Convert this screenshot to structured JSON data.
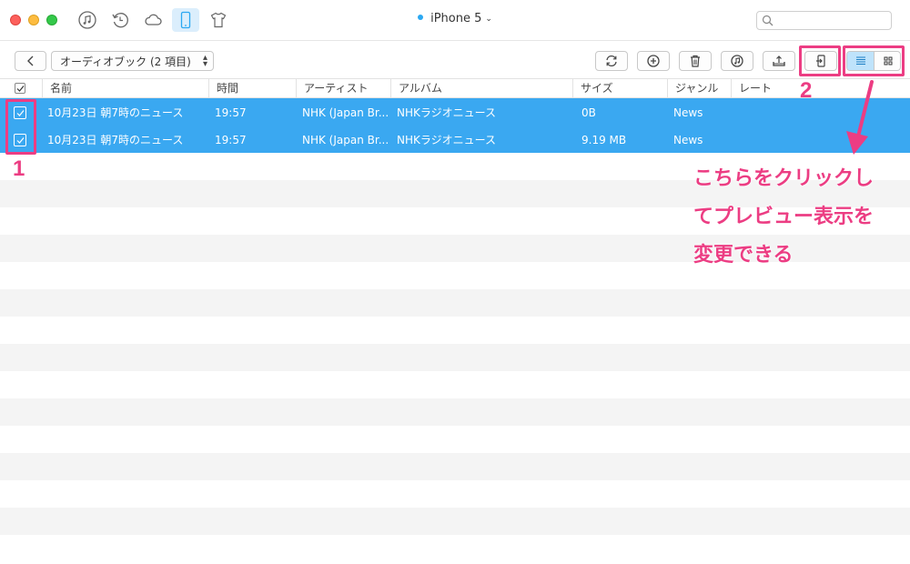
{
  "titlebar": {
    "device_name": "iPhone 5",
    "search_placeholder": "",
    "icons": [
      "music-icon",
      "restore-icon",
      "cloud-icon",
      "phone-icon",
      "tshirt-icon"
    ]
  },
  "toolbar": {
    "dropdown_label": "オーディオブック (2 項目)",
    "actions": [
      "refresh-icon",
      "add-icon",
      "delete-icon",
      "add-to-itunes-icon",
      "export-to-pc-icon",
      "send-to-device-icon"
    ]
  },
  "table": {
    "columns": [
      "名前",
      "時間",
      "アーティスト",
      "アルバム",
      "サイズ",
      "ジャンル",
      "レート"
    ],
    "rows": [
      {
        "name": "10月23日 朝7時のニュース",
        "time": "19:57",
        "artist": "NHK (Japan Br...",
        "album": "NHKラジオニュース",
        "size": "0B",
        "genre": "News",
        "rate": ""
      },
      {
        "name": "10月23日 朝7時のニュース",
        "time": "19:57",
        "artist": "NHK (Japan Br...",
        "album": "NHKラジオニュース",
        "size": "9.19 MB",
        "genre": "News",
        "rate": ""
      }
    ]
  },
  "annotations": {
    "num1": "1",
    "num2": "2",
    "line1": "こちらをクリックし",
    "line2": "てプレビュー表示を",
    "line3": "変更できる",
    "color": "#ec3d83"
  },
  "colors": {
    "selection": "#3aa8f1",
    "accent": "#2ba8f2"
  }
}
